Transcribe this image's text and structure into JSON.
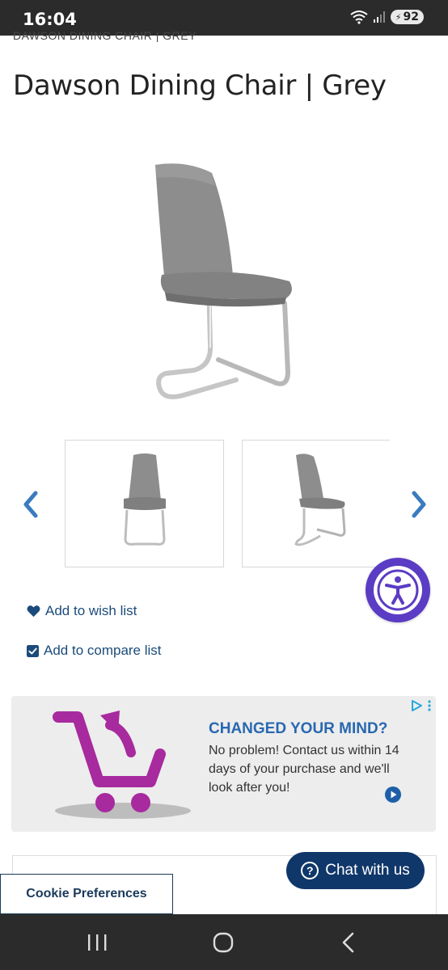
{
  "status_bar": {
    "time": "16:04",
    "battery": "92",
    "icons": [
      "wifi-icon",
      "signal-icon",
      "battery-icon"
    ]
  },
  "breadcrumb": "DAWSON DINING CHAIR | GREY",
  "product": {
    "title": "Dawson Dining Chair | Grey",
    "image_color": "#8c8c8c"
  },
  "gallery": {
    "prev_icon": "chevron-left-icon",
    "next_icon": "chevron-right-icon",
    "thumbnails": [
      "front view",
      "side view"
    ]
  },
  "actions": {
    "wishlist_label": "Add to wish list",
    "compare_label": "Add to compare list"
  },
  "ad": {
    "headline": "CHANGED YOUR MIND?",
    "body": "No problem! Contact us within 14 days of your purchase and we'll look after you!",
    "accent": "#a72a9e"
  },
  "cookie": {
    "label": "Cookie Preferences"
  },
  "chat": {
    "label": "Chat with us",
    "icon": "?"
  },
  "colors": {
    "brand": "#1b4b7a",
    "chat_bg": "#10376a",
    "accessibility": "#5b3cc4"
  }
}
